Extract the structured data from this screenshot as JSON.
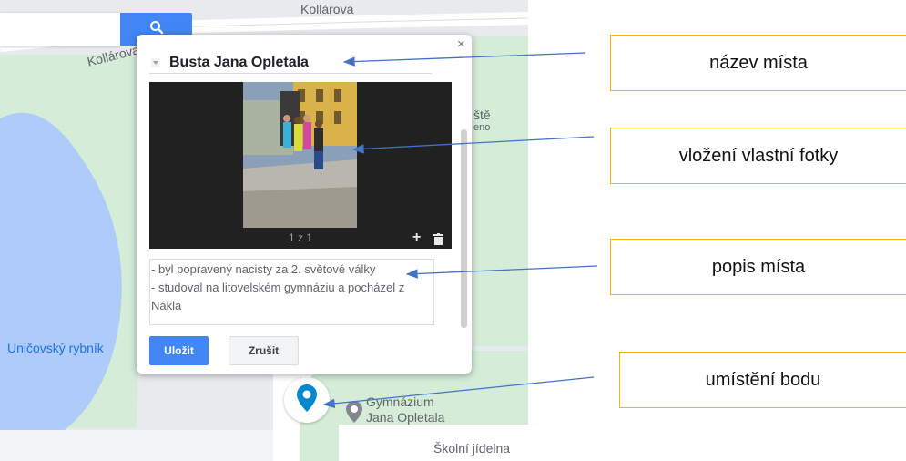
{
  "map": {
    "street_top": "Kollárova",
    "street_left": "Kollárova",
    "pond_label": "Uničovský rybník",
    "school_label_line1": "Gymnázium",
    "school_label_line2": "Jana Opletala",
    "canteen_label": "Školní jídelna",
    "playground_label_line1": "ště",
    "playground_label_line2": "eno"
  },
  "popup": {
    "close_symbol": "×",
    "title": "Busta Jana Opletala",
    "photo_counter": "1 z 1",
    "add_photo_symbol": "+",
    "description_lines": [
      "- byl popravený nacisty za 2. světové války",
      "- studoval na litovelském gymnáziu a pocházel z",
      "Nákla"
    ],
    "save_label": "Uložit",
    "cancel_label": "Zrušit"
  },
  "callouts": [
    {
      "label": "název místa"
    },
    {
      "label": "vložení vlastní fotky"
    },
    {
      "label": "popis místa"
    },
    {
      "label": "umístění bodu"
    }
  ],
  "colors": {
    "accent": "#4285f4",
    "callout_border": "#f2b80d",
    "arrow": "#4472c4"
  }
}
